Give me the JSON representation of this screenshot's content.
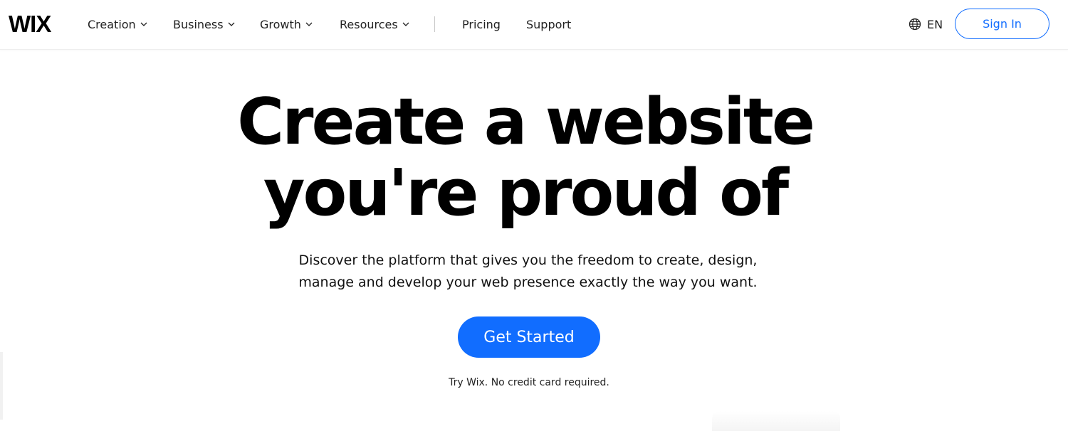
{
  "brand": {
    "logo_text": "WIX"
  },
  "nav": {
    "items": [
      {
        "label": "Creation",
        "has_dropdown": true
      },
      {
        "label": "Business",
        "has_dropdown": true
      },
      {
        "label": "Growth",
        "has_dropdown": true
      },
      {
        "label": "Resources",
        "has_dropdown": true
      },
      {
        "label": "Pricing",
        "has_dropdown": false
      },
      {
        "label": "Support",
        "has_dropdown": false
      }
    ]
  },
  "language": {
    "label": "EN",
    "icon": "globe-icon"
  },
  "auth": {
    "signin_label": "Sign In"
  },
  "hero": {
    "title_line1": "Create a website",
    "title_line2": "you're proud of",
    "subtitle_line1": "Discover the platform that gives you the freedom to create, design,",
    "subtitle_line2": "manage and develop your web presence exactly the way you want.",
    "cta_label": "Get Started",
    "note": "Try Wix. No credit card required."
  },
  "colors": {
    "accent": "#116dff",
    "text": "#000000",
    "background": "#ffffff"
  }
}
